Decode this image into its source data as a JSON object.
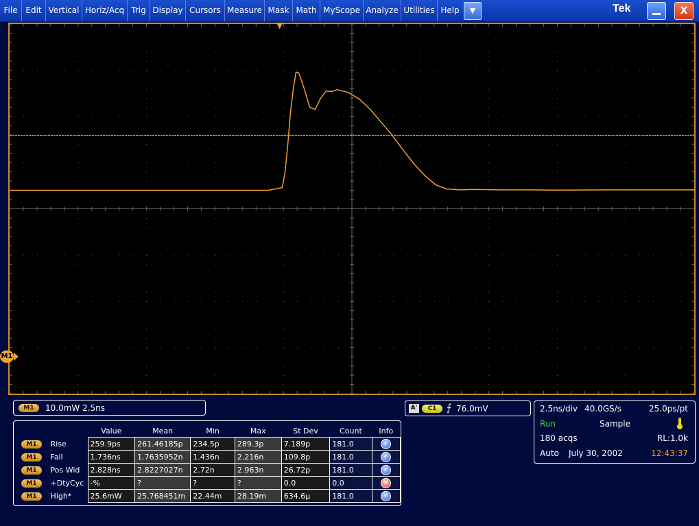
{
  "menu": {
    "items": [
      "File",
      "Edit",
      "Vertical",
      "Horiz/Acq",
      "Trig",
      "Display",
      "Cursors",
      "Measure",
      "Mask",
      "Math",
      "MyScope",
      "Analyze",
      "Utilities",
      "Help"
    ],
    "dropdown_glyph": "▼",
    "brand": "Tek",
    "close_glyph": "X"
  },
  "colors": {
    "trace": "#f0a030",
    "menu_bar": "#1543bd",
    "background": "#000a3c"
  },
  "scope": {
    "ref_marker": "M1",
    "trigger_marker_glyph": "▼"
  },
  "chart_data": {
    "type": "line",
    "title": "",
    "xlabel": "",
    "ylabel": "",
    "grid": true,
    "divisions": {
      "x": 10,
      "y": 8
    },
    "units": {
      "x": "ns",
      "y": "mW"
    },
    "x_per_div": 2.5,
    "y_per_div": 10.0,
    "xlim": [
      -9.96,
      15.04
    ],
    "ylim": [
      -44,
      36
    ],
    "trigger_level_mw": 11.9,
    "series": [
      {
        "x": [
          -9.96,
          -0.5,
          0,
          0.1,
          0.2,
          0.3,
          0.4,
          0.5,
          0.6,
          0.8,
          1.0,
          1.2,
          1.4,
          1.6,
          1.8,
          2.0,
          2.4,
          2.8,
          3.2,
          3.6,
          4.0,
          4.4,
          4.8,
          5.2,
          5.6,
          6.0,
          6.5,
          7.0,
          8.0,
          9.0,
          10.0,
          12.0,
          15.04
        ],
        "y": [
          0,
          0,
          0.6,
          4,
          10,
          17,
          22,
          25.6,
          25.4,
          22,
          18,
          17.5,
          20,
          21.5,
          21.4,
          21.8,
          21.2,
          19.8,
          17.6,
          14.8,
          12,
          8.8,
          5.8,
          3.2,
          1.2,
          0.3,
          0.1,
          0.2,
          0.1,
          0.1,
          0.05,
          0.1,
          0.1
        ]
      }
    ]
  },
  "channel_readout": {
    "badge": "M1",
    "text": "10.0mW 2.5ns"
  },
  "measurements": {
    "columns": [
      "Value",
      "Mean",
      "Min",
      "Max",
      "St Dev",
      "Count",
      "Info"
    ],
    "rows": [
      {
        "badge": "M1",
        "name": "Rise",
        "value": "259.9ps",
        "mean": "261.46185p",
        "min": "234.5p",
        "max": "289.3p",
        "stdev": "7.189p",
        "count": "181.0",
        "info": "ok"
      },
      {
        "badge": "M1",
        "name": "Fall",
        "value": "1.736ns",
        "mean": "1.7635952n",
        "min": "1.436n",
        "max": "2.216n",
        "stdev": "109.8p",
        "count": "181.0",
        "info": "ok"
      },
      {
        "badge": "M1",
        "name": "Pos Wid",
        "value": "2.828ns",
        "mean": "2.8227027n",
        "min": "2.72n",
        "max": "2.963n",
        "stdev": "26.72p",
        "count": "181.0",
        "info": "ok"
      },
      {
        "badge": "M1",
        "name": "+DtyCyc",
        "value": "-%",
        "mean": "?",
        "min": "?",
        "max": "?",
        "stdev": "0.0",
        "count": "0.0",
        "info": "error"
      },
      {
        "badge": "M1",
        "name": "High*",
        "value": "25.6mW",
        "mean": "25.768451m",
        "min": "22.44m",
        "max": "28.19m",
        "stdev": "634.6µ",
        "count": "181.0",
        "info": "ok"
      }
    ]
  },
  "trigger": {
    "mode_badge": "A'",
    "channel_badge": "C1",
    "slope_glyph": "⨍",
    "level": "76.0mV"
  },
  "acquisition": {
    "timebase": "2.5ns/div",
    "sample_rate": "40.0GS/s",
    "resolution": "25.0ps/pt",
    "state": "Run",
    "mode": "Sample",
    "acqs": "180 acqs",
    "record_length": "RL:1.0k",
    "trigger_mode": "Auto",
    "date": "July 30, 2002",
    "time": "12:43:37"
  }
}
